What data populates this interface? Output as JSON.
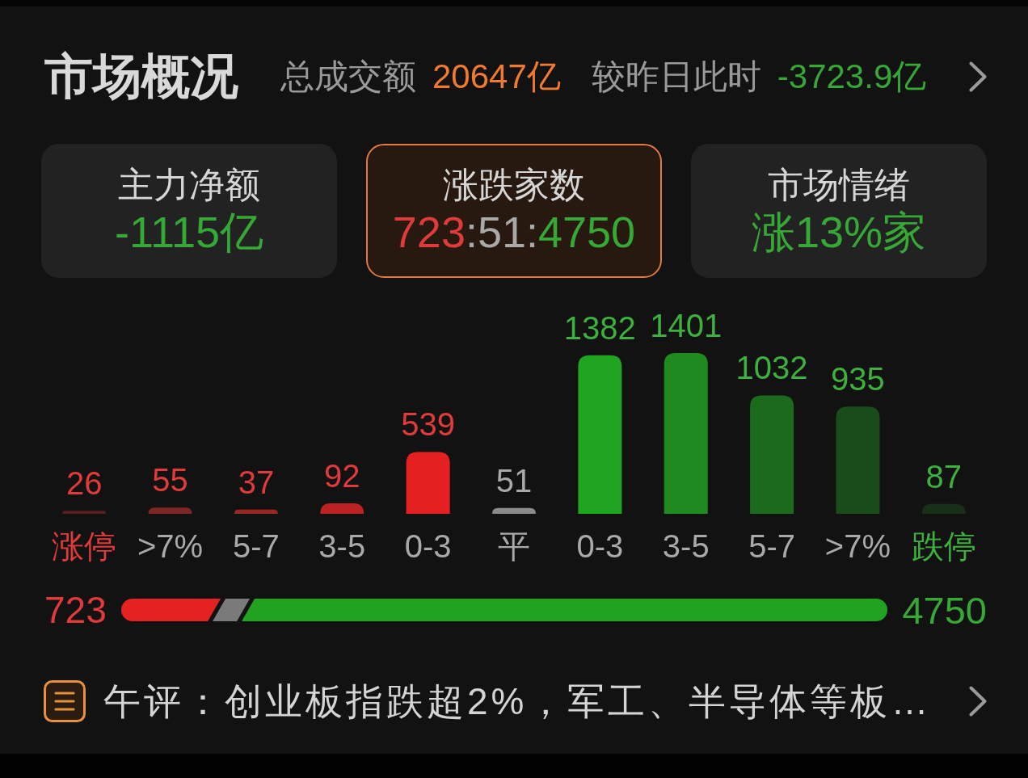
{
  "header": {
    "title": "市场概况",
    "turnover_label": "总成交额",
    "turnover_value": "20647亿",
    "change_label": "较昨日此时",
    "change_value": "-3723.9亿"
  },
  "cards": [
    {
      "title": "主力净额",
      "value_parts": [
        {
          "text": "-1115亿",
          "color": "#35a835"
        }
      ],
      "selected": false
    },
    {
      "title": "涨跌家数",
      "value_parts": [
        {
          "text": "723",
          "color": "#e03a3a"
        },
        {
          "text": ":51:",
          "color": "#a9a9a9"
        },
        {
          "text": "4750",
          "color": "#35a835"
        }
      ],
      "selected": true
    },
    {
      "title": "市场情绪",
      "value_parts": [
        {
          "text": "涨13%家",
          "color": "#35a835"
        }
      ],
      "selected": false
    }
  ],
  "distribution": {
    "chart_data": {
      "type": "bar",
      "categories": [
        "涨停",
        ">7%",
        "5-7",
        "3-5",
        "0-3",
        "平",
        "0-3",
        "3-5",
        "5-7",
        ">7%",
        "跌停"
      ],
      "values": [
        26,
        55,
        37,
        92,
        539,
        51,
        1382,
        1401,
        1032,
        935,
        87
      ],
      "colors": [
        "#5a1f1f",
        "#7e2626",
        "#9a2626",
        "#bd2222",
        "#e52020",
        "#8a8a8a",
        "#20a520",
        "#1f8a1f",
        "#1c6a1c",
        "#1a4c1a",
        "#173017"
      ],
      "data_labels": true
    }
  },
  "ratio": {
    "up_count": "723",
    "down_count": "4750",
    "level": 0.13
  },
  "news": {
    "text": "午评：创业板指跌超2%，军工、半导体等板…"
  }
}
